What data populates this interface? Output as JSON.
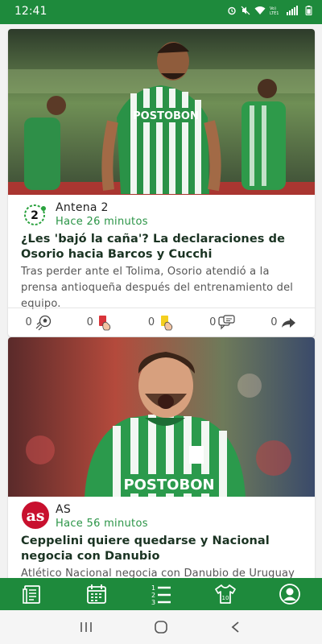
{
  "status_bar": {
    "time": "12:41",
    "icons": [
      "alarm-icon",
      "mute-icon",
      "wifi-icon",
      "volte-icon",
      "signal-icon",
      "battery-icon"
    ]
  },
  "articles": [
    {
      "source": "Antena 2",
      "time": "Hace 26 minutos",
      "title": "¿Les 'bajó la caña'? La declaraciones de Osorio hacia Barcos y Cucchi",
      "summary": "Tras perder ante el Tolima, Osorio atendió a la prensa antioqueña después del entrenamiento del equipo.",
      "image_text": "POSTOBON",
      "reactions": {
        "goal": "0",
        "red_card": "0",
        "yellow_card": "0",
        "comments": "0",
        "share": "0"
      }
    },
    {
      "source": "AS",
      "time": "Hace 56 minutos",
      "title": "Ceppelini quiere quedarse y Nacional negocia con Danubio",
      "summary": "Atlético Nacional negocia con Danubio de Uruguay",
      "image_text": "POSTOBON"
    }
  ],
  "logos": {
    "antena2": "2",
    "as": "as"
  },
  "bottom_nav": [
    "news-icon",
    "calendar-icon",
    "standings-icon",
    "jersey-icon",
    "profile-icon"
  ],
  "colors": {
    "brand_green": "#1e8a3c",
    "time_green": "#2a9446"
  }
}
